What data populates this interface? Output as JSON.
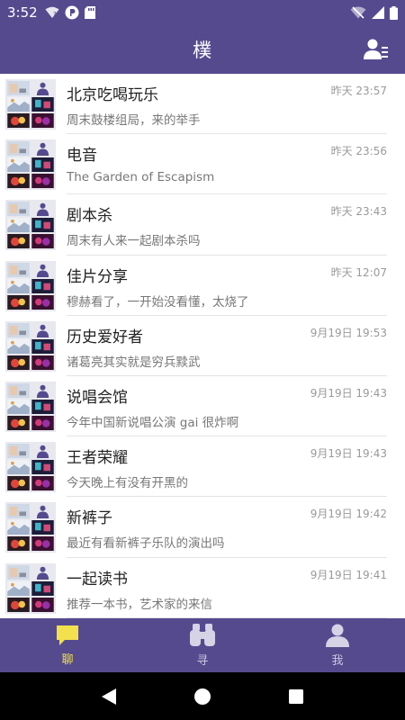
{
  "status_bar": {
    "time": "3:52"
  },
  "app_bar": {
    "title": "樸"
  },
  "chats": [
    {
      "name": "北京吃喝玩乐",
      "last_message": "周末鼓楼组局，来的举手",
      "time": "昨天 23:57"
    },
    {
      "name": "电音",
      "last_message": "The Garden of Escapism",
      "time": "昨天 23:56"
    },
    {
      "name": "剧本杀",
      "last_message": "周末有人来一起剧本杀吗",
      "time": "昨天 23:43"
    },
    {
      "name": "佳片分享",
      "last_message": "穆赫看了，一开始没看懂，太烧了",
      "time": "昨天 12:07"
    },
    {
      "name": "历史爱好者",
      "last_message": "诸葛亮其实就是穷兵黩武",
      "time": "9月19日 19:53"
    },
    {
      "name": "说唱会馆",
      "last_message": "今年中国新说唱公演 gai 很炸啊",
      "time": "9月19日 19:43"
    },
    {
      "name": "王者荣耀",
      "last_message": "今天晚上有没有开黑的",
      "time": "9月19日 19:43"
    },
    {
      "name": "新裤子",
      "last_message": "最近有看新裤子乐队的演出吗",
      "time": "9月19日 19:42"
    },
    {
      "name": "一起读书",
      "last_message": "推荐一本书，艺术家的来信",
      "time": "9月19日 19:41"
    }
  ],
  "bottom_nav": [
    {
      "label": "聊",
      "icon": "chat-bubble-icon",
      "active": true
    },
    {
      "label": "寻",
      "icon": "binoculars-icon",
      "active": false
    },
    {
      "label": "我",
      "icon": "person-icon",
      "active": false
    }
  ],
  "colors": {
    "primary": "#564a8f",
    "active_tab": "#f2e14c"
  }
}
